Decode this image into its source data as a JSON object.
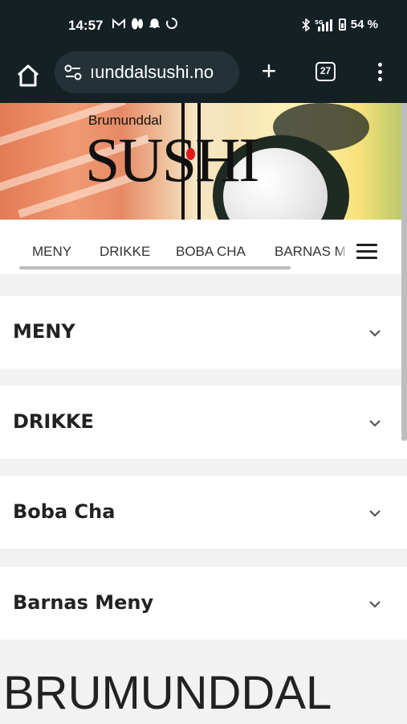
{
  "status_bar": {
    "time": "14:57",
    "battery": "54 %"
  },
  "browser": {
    "url": "ıunddalsushi.no",
    "tab_count": "27"
  },
  "hero": {
    "logo_small": "Brumunddal",
    "logo_big": "SUSHI"
  },
  "nav": {
    "items": [
      "MENY",
      "DRIKKE",
      "BOBA CHA",
      "BARNAS MENY"
    ]
  },
  "sections": [
    {
      "title": "MENY"
    },
    {
      "title": "DRIKKE"
    },
    {
      "title": "Boba Cha"
    },
    {
      "title": "Barnas Meny"
    }
  ],
  "footer": {
    "heading": "BRUMUNDDAL"
  },
  "colors": {
    "browser_chrome": "#152025",
    "url_box": "#243238",
    "logo_dot": "#e0181b"
  }
}
